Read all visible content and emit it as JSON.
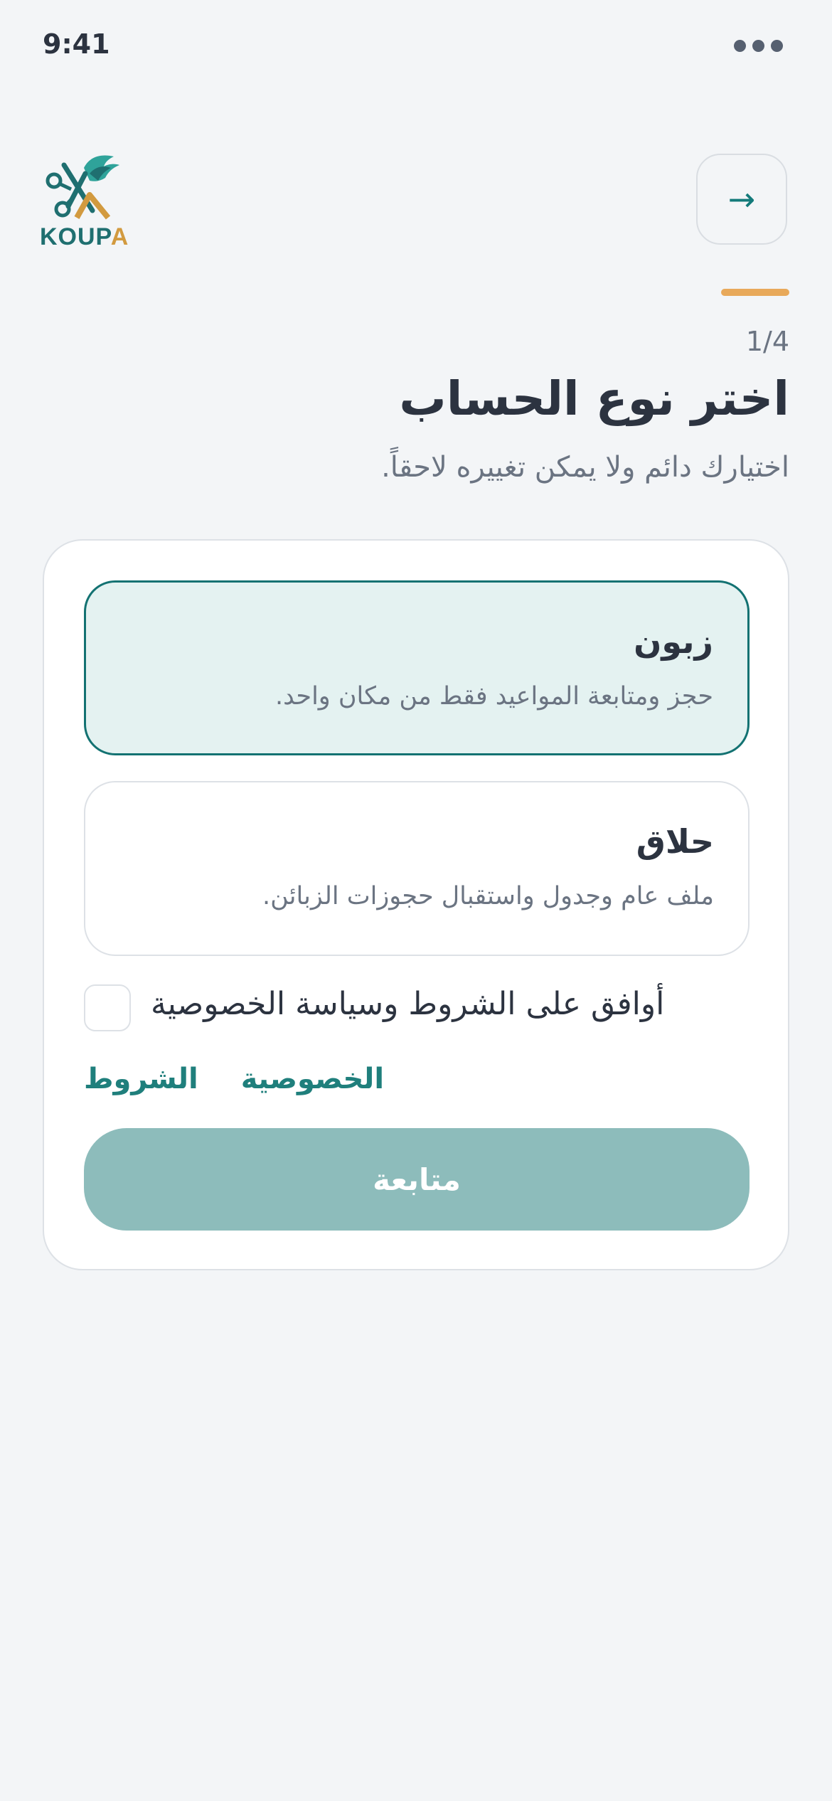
{
  "status_bar": {
    "time": "9:41"
  },
  "logo": {
    "text_part1": "KOUP",
    "text_part2": "A",
    "color_primary": "#1f6f70",
    "color_accent": "#d29a3f"
  },
  "header": {
    "back_icon": "arrow-right-icon",
    "back_glyph": "→",
    "step": "1/4",
    "progress_fraction": 0.25,
    "title": "اختر نوع الحساب",
    "subtitle": "اختيارك دائم ولا يمكن تغييره لاحقاً."
  },
  "options": [
    {
      "title": "زبون",
      "description": "حجز ومتابعة المواعيد فقط من مكان واحد.",
      "selected": true
    },
    {
      "title": "حلاق",
      "description": "ملف عام وجدول واستقبال حجوزات الزبائن.",
      "selected": false
    }
  ],
  "agreement": {
    "label": "أوافق على الشروط وسياسة الخصوصية",
    "checked": false
  },
  "links": {
    "terms": "الشروط",
    "privacy": "الخصوصية"
  },
  "continue_button": {
    "label": "متابعة",
    "disabled": true
  },
  "colors": {
    "accent": "#137272",
    "selected_bg": "#e4f2f1",
    "progress": "#e8a95a",
    "button_disabled": "#8dbcbb"
  }
}
